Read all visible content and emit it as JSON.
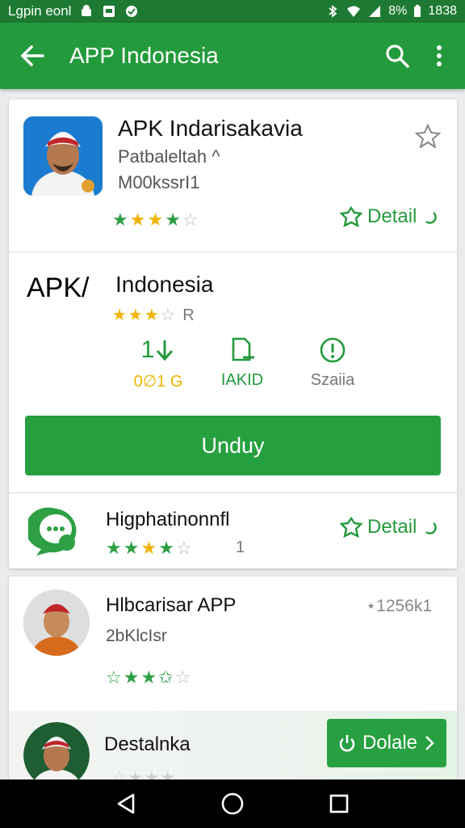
{
  "status_bar": {
    "carrier": "Lgpin eonl",
    "battery": "8%",
    "time": "1838"
  },
  "app_bar": {
    "title": "APP Indonesia"
  },
  "featured": {
    "title": "APK Indarisakavia",
    "line1": "Patbaleltah ^",
    "line2": "M00kssrI1",
    "detail_label": "Detail"
  },
  "main_app": {
    "title_prefix": "APK/",
    "title": "Indonesia",
    "rating_suffix": "R",
    "stats": [
      {
        "label": "0∅1 G",
        "icon": "download-icon"
      },
      {
        "label": "IAKID",
        "icon": "document-icon"
      },
      {
        "label": "Szaiia",
        "icon": "info-icon"
      }
    ],
    "stat_value": "1",
    "download_label": "Unduy"
  },
  "related": {
    "title": "Higphatinonnfl",
    "count": "1",
    "detail_label": "Detail"
  },
  "list": [
    {
      "title": "Hlbcarisar APP",
      "subtitle": "2bKlcIsr",
      "meta": "⋆1256k1"
    },
    {
      "title": "Destalnka",
      "action_label": "Dolale"
    }
  ]
}
